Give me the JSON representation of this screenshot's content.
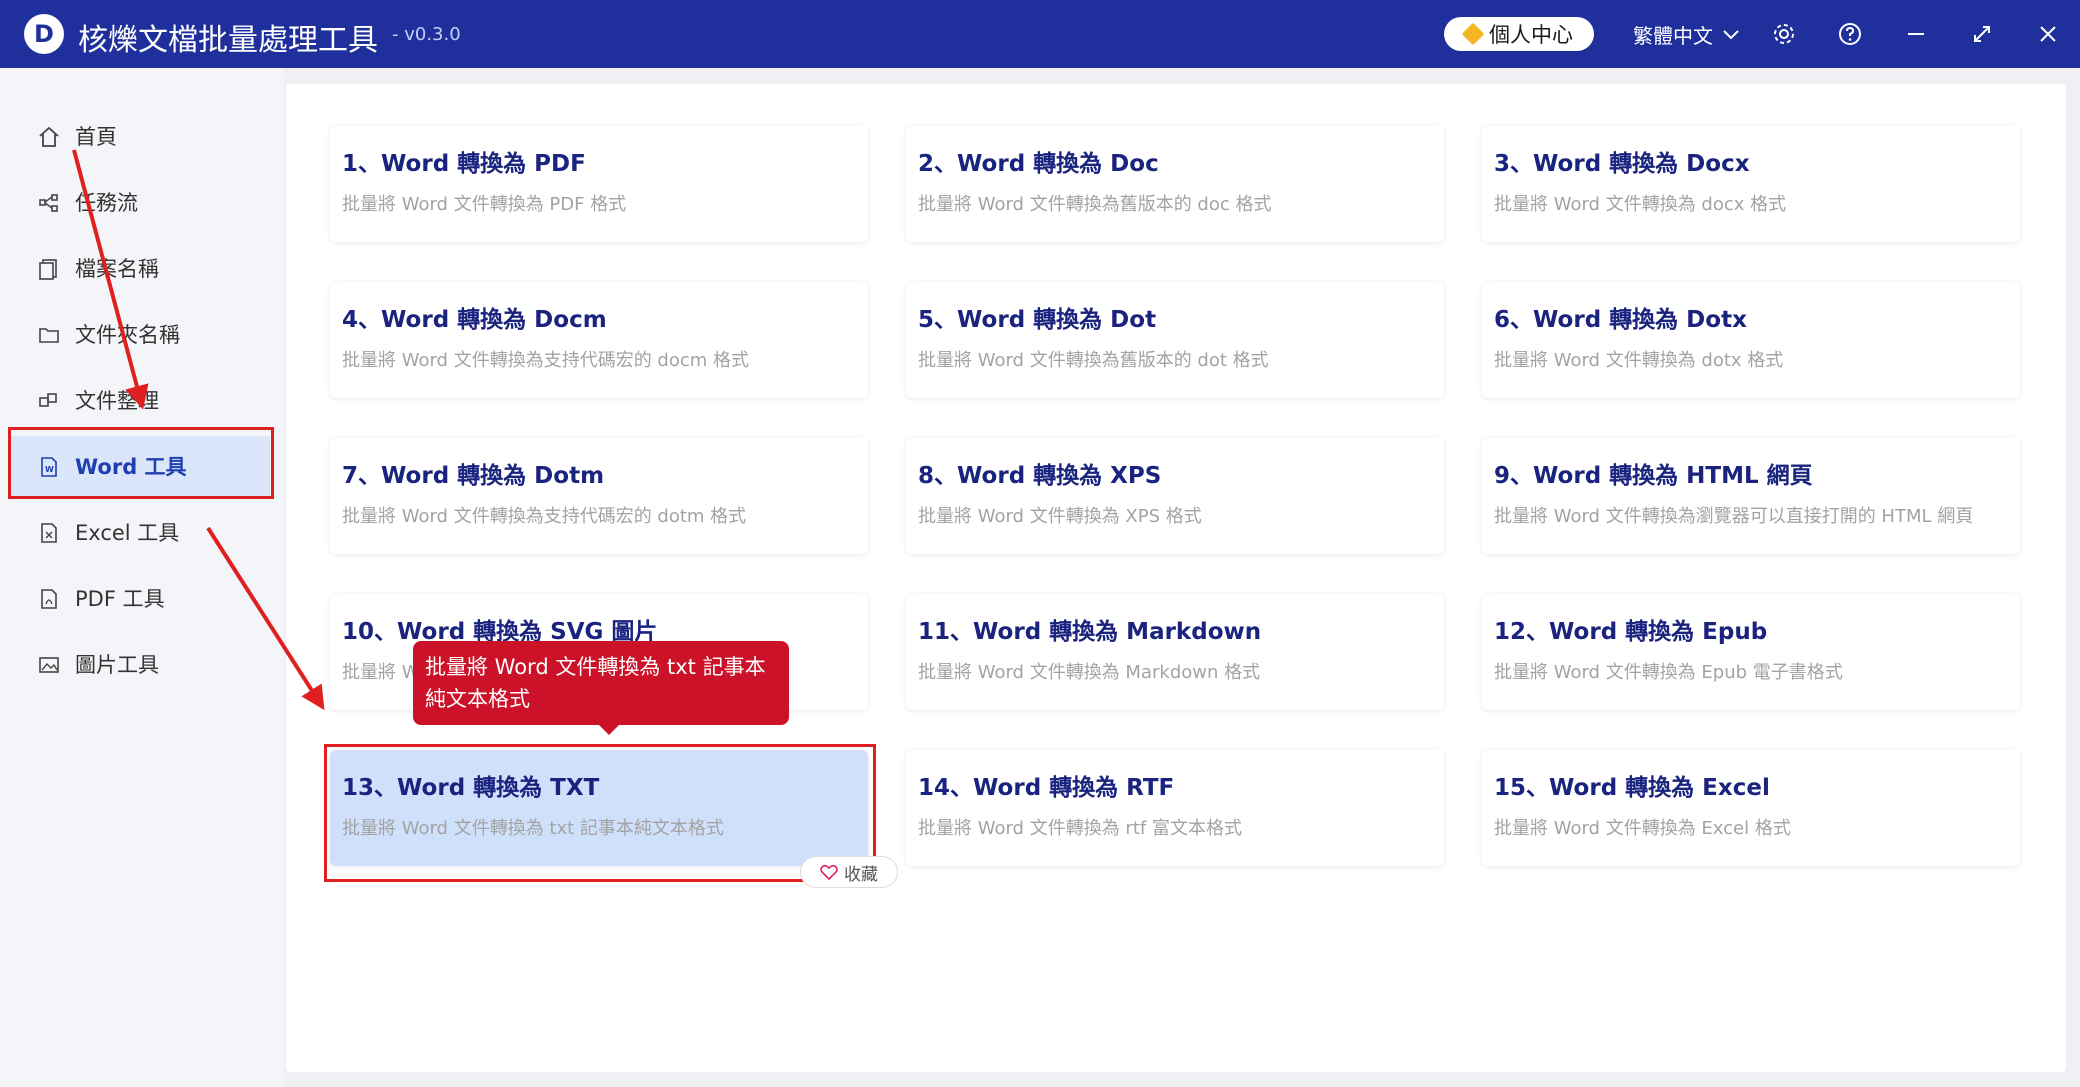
{
  "titlebar": {
    "logo_letter": "D",
    "title": "核爍文檔批量處理工具",
    "version": "- v0.3.0",
    "user_center": "個人中心",
    "language": "繁體中文"
  },
  "sidebar": {
    "items": [
      {
        "label": "首頁",
        "icon": "home-icon"
      },
      {
        "label": "任務流",
        "icon": "workflow-icon"
      },
      {
        "label": "檔案名稱",
        "icon": "file-name-icon"
      },
      {
        "label": "文件夾名稱",
        "icon": "folder-icon"
      },
      {
        "label": "文件整理",
        "icon": "organize-icon"
      },
      {
        "label": "Word 工具",
        "icon": "word-icon",
        "active": true
      },
      {
        "label": "Excel 工具",
        "icon": "excel-icon"
      },
      {
        "label": "PDF 工具",
        "icon": "pdf-icon"
      },
      {
        "label": "圖片工具",
        "icon": "image-icon"
      }
    ]
  },
  "cards": [
    {
      "title": "1、Word 轉換為 PDF",
      "desc": "批量將 Word 文件轉換為 PDF 格式"
    },
    {
      "title": "2、Word 轉換為 Doc",
      "desc": "批量將 Word 文件轉換為舊版本的 doc 格式"
    },
    {
      "title": "3、Word 轉換為 Docx",
      "desc": "批量將 Word 文件轉換為 docx 格式"
    },
    {
      "title": "4、Word 轉換為 Docm",
      "desc": "批量將 Word 文件轉換為支持代碼宏的 docm 格式"
    },
    {
      "title": "5、Word 轉換為 Dot",
      "desc": "批量將 Word 文件轉換為舊版本的 dot 格式"
    },
    {
      "title": "6、Word 轉換為 Dotx",
      "desc": "批量將 Word 文件轉換為 dotx 格式"
    },
    {
      "title": "7、Word 轉換為 Dotm",
      "desc": "批量將 Word 文件轉換為支持代碼宏的 dotm 格式"
    },
    {
      "title": "8、Word 轉換為 XPS",
      "desc": "批量將 Word 文件轉換為 XPS 格式"
    },
    {
      "title": "9、Word 轉換為 HTML 網頁",
      "desc": "批量將 Word 文件轉換為瀏覽器可以直接打開的 HTML 網頁"
    },
    {
      "title": "10、Word 轉換為 SVG 圖片",
      "desc": "批量將 W"
    },
    {
      "title": "11、Word 轉換為 Markdown",
      "desc": "批量將 Word 文件轉換為 Markdown 格式"
    },
    {
      "title": "12、Word 轉換為 Epub",
      "desc": "批量將 Word 文件轉換為 Epub 電子書格式"
    },
    {
      "title": "13、Word 轉換為 TXT",
      "desc": "批量將 Word 文件轉換為 txt 記事本純文本格式"
    },
    {
      "title": "14、Word 轉換為 RTF",
      "desc": "批量將 Word 文件轉換為 rtf 富文本格式"
    },
    {
      "title": "15、Word 轉換為 Excel",
      "desc": "批量將 Word 文件轉換為 Excel 格式"
    }
  ],
  "tooltip": "批量將 Word 文件轉換為 txt 記事本純文本格式",
  "favorite_label": "收藏",
  "colors": {
    "titlebar": "#1f2f9c",
    "accent": "#1a237e",
    "annotation": "#e02020",
    "tooltip": "#cb1229",
    "selected_card": "#cfe0fb"
  }
}
